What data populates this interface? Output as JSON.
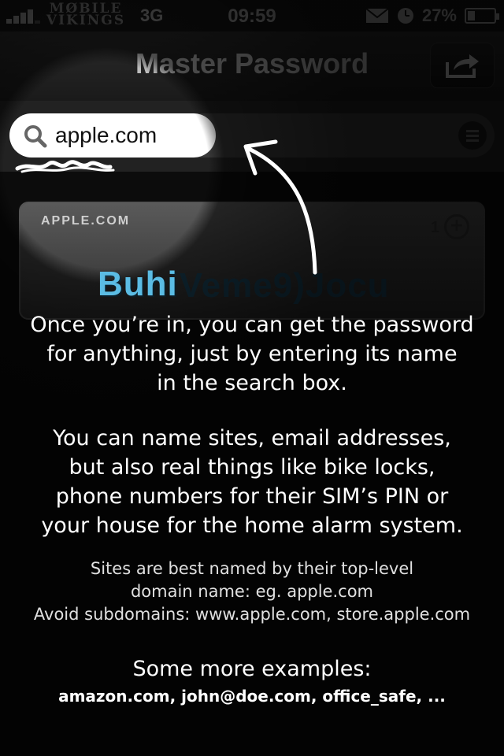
{
  "status_bar": {
    "carrier_line1": "MØBILE",
    "carrier_line2": "VIKINGS",
    "network": "3G",
    "time": "09:59",
    "battery": "27%",
    "battery_level": 0.27
  },
  "nav": {
    "title": "Master Password",
    "share_icon": "share-icon"
  },
  "search": {
    "value": "apple.com",
    "icon": "search-icon"
  },
  "card": {
    "site": "APPLE.COM",
    "counter": "1",
    "password": "BuhiVeme9)Jocu",
    "password_visible": "Buhi"
  },
  "help": {
    "p1": [
      "Once you’re in, you can get the password",
      "for anything, just by entering its name",
      "in the search box."
    ],
    "p2": [
      "You can name sites, email addresses,",
      "but also real things like bike locks,",
      "phone numbers for their SIM’s PIN or",
      "your house for the home alarm system."
    ],
    "p3": [
      "Sites are best named by their top-level",
      "domain name: eg. apple.com",
      "Avoid subdomains: www.apple.com, store.apple.com"
    ],
    "p4": "Some more examples:",
    "p5": "amazon.com, john@doe.com, office_safe, ..."
  }
}
